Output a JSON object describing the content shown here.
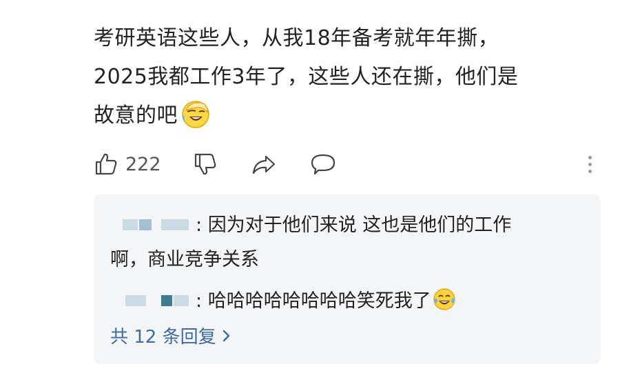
{
  "comment": {
    "lines": [
      "考研英语这些人，从我18年备考就年年撕，",
      "2025我都工作3年了，这些人还在撕，他们是",
      "故意的吧"
    ],
    "emoji": "facepalm-laugh-emoji"
  },
  "actions": {
    "like_count": "222",
    "icons": [
      "thumbs-up-icon",
      "thumbs-down-icon",
      "share-icon",
      "comment-icon",
      "more-icon"
    ]
  },
  "replies": [
    {
      "username_hidden": true,
      "separator": ":",
      "text_line1": " 因为对于他们来说 这也是他们的工作",
      "text_line2": "啊，商业竞争关系"
    },
    {
      "username_hidden": true,
      "separator": ":",
      "text": " 哈哈哈哈哈哈哈哈笑死我了",
      "emoji": "tears-of-joy-emoji"
    }
  ],
  "view_replies": {
    "label": "共 12 条回复",
    "icon": "chevron-right-icon"
  },
  "colors": {
    "link": "#3d6aa3",
    "reply_bg": "#f4f5f7",
    "text": "#222222",
    "icon": "#444444"
  }
}
